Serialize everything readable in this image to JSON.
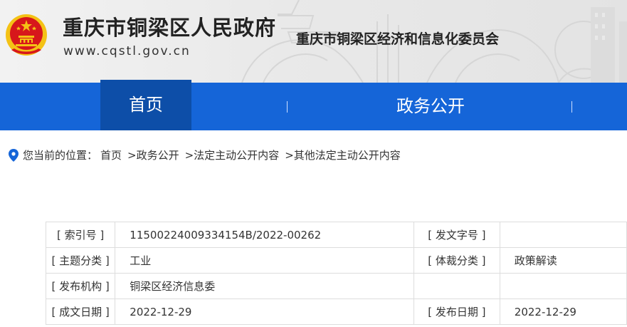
{
  "header": {
    "site_title": "重庆市铜梁区人民政府",
    "site_url": "www.cqstl.gov.cn",
    "dept_title": "重庆市铜梁区经济和信息化委员会"
  },
  "nav": {
    "items": [
      {
        "label": "首页",
        "active": true
      },
      {
        "label": "政务公开",
        "active": false
      }
    ]
  },
  "breadcrumb": {
    "label": "您当前的位置：",
    "items": [
      "首页",
      ">政务公开",
      ">法定主动公开内容",
      ">其他法定主动公开内容"
    ]
  },
  "info": {
    "rows": [
      {
        "label1": "[ 索引号 ]",
        "value1": "11500224009334154B/2022-00262",
        "label2": "[ 发文字号 ]",
        "value2": ""
      },
      {
        "label1": "[ 主题分类 ]",
        "value1": "工业",
        "label2": "[ 体裁分类 ]",
        "value2": "政策解读"
      },
      {
        "label1": "[ 发布机构 ]",
        "value1": "铜梁区经济信息委",
        "label2": "",
        "value2": ""
      },
      {
        "label1": "[ 成文日期 ]",
        "value1": "2022-12-29",
        "label2": "[ 发布日期 ]",
        "value2": "2022-12-29"
      }
    ]
  },
  "colors": {
    "nav_bg": "#1565d8",
    "nav_active_bg": "#0d4ea8",
    "emblem_red": "#d7171b",
    "emblem_gold": "#f4c215",
    "pin_blue": "#1565d8"
  }
}
